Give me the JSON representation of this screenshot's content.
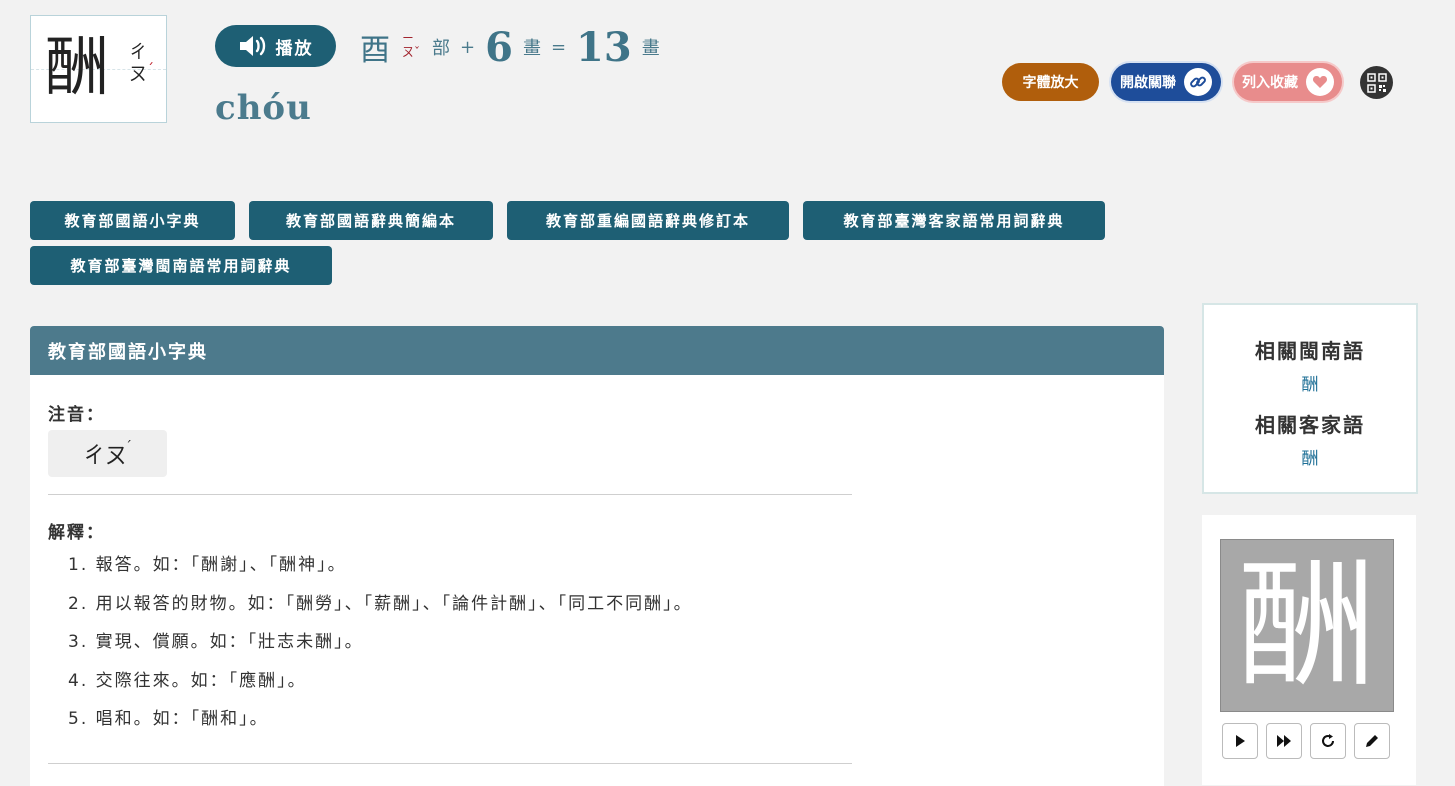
{
  "header": {
    "character": "酬",
    "zhuyin_parts": [
      "ㄔ",
      "ㄡ"
    ],
    "tone_mark": "ˊ",
    "play_label": "播放",
    "radical": "酉",
    "radical_zhuyin_top": "ㄧ",
    "radical_zhuyin_bottom": "ㄡˇ",
    "radical_suffix": "部",
    "plus": "+",
    "extra_strokes": "6",
    "strokes_unit": "畫",
    "equals": "=",
    "total_strokes": "13",
    "pinyin": "chóu"
  },
  "actions": {
    "enlarge_label": "字體放大",
    "link_label": "開啟關聯",
    "favorite_label": "列入收藏",
    "qr_icon": "qr-code-icon",
    "colors": {
      "enlarge": "#b05e0c",
      "link": "#1e4d9a",
      "favorite": "#e88c8c"
    }
  },
  "dictionaries": [
    "教育部國語小字典",
    "教育部國語辭典簡編本",
    "教育部重編國語辭典修訂本",
    "教育部臺灣客家語常用詞辭典",
    "教育部臺灣閩南語常用詞辭典"
  ],
  "entry": {
    "title": "教育部國語小字典",
    "zhuyin_label": "注音：",
    "zhuyin_value": "ㄔㄡ",
    "zhuyin_tone": "ˊ",
    "explanation_label": "解釋：",
    "definitions": [
      "1. 報答。如：「酬謝」、「酬神」。",
      "2. 用以報答的財物。如：「酬勞」、「薪酬」、「論件計酬」、「同工不同酬」。",
      "3. 實現、償願。如：「壯志未酬」。",
      "4. 交際往來。如：「應酬」。",
      "5. 唱和。如：「酬和」。"
    ]
  },
  "related": {
    "minnan_title": "相關閩南語",
    "minnan_link": "酬",
    "hakka_title": "相關客家語",
    "hakka_link": "酬"
  },
  "stroke": {
    "character": "酬",
    "controls": [
      "play-icon",
      "fast-forward-icon",
      "replay-icon",
      "pencil-icon"
    ]
  },
  "theme": {
    "primary": "#1e5f74",
    "panel_header": "#4d7a8c",
    "background": "#f2f2f2"
  }
}
